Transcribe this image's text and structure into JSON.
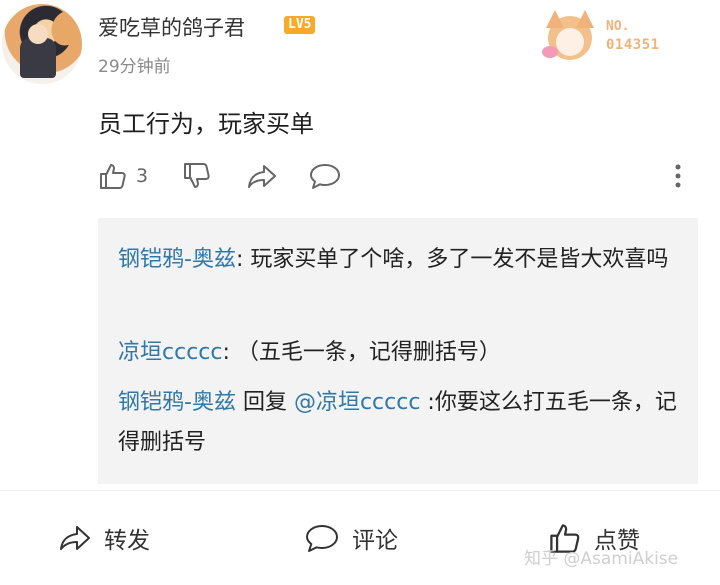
{
  "comment": {
    "username": "爱吃草的鸽子君",
    "level": "LV5",
    "timestamp": "29分钟前",
    "badge": {
      "label": "NO.",
      "number": "014351"
    },
    "text": "员工行为，玩家买单",
    "like_count": "3"
  },
  "replies": [
    {
      "author": "钢铠鸦-奥兹",
      "sep": ": ",
      "text": "玩家买单了个啥，多了一发不是皆大欢喜吗"
    },
    {
      "author": "凉垣ccccc",
      "sep": ": ",
      "text": "（五毛一条，记得删括号）"
    },
    {
      "author": "钢铠鸦-奥兹",
      "reply_word": " 回复 ",
      "mention": "@凉垣ccccc",
      "sep": " :",
      "text": "你要这么打五毛一条，记得删括号"
    }
  ],
  "bottom_bar": {
    "forward_label": "转发",
    "comment_label": "评论",
    "like_label": "点赞"
  },
  "watermark": "知乎 @AsamiAkise",
  "colors": {
    "author_link": "#2f78a8",
    "level_badge": "#f7a92a",
    "badge_text": "#f2b37a",
    "reply_background": "#f3f3f3"
  }
}
